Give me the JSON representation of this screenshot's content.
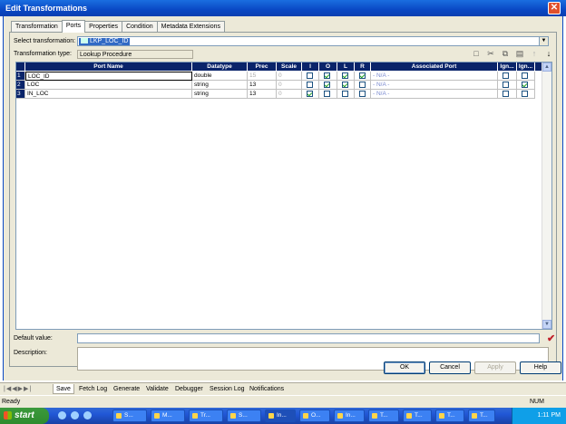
{
  "window": {
    "title": "Edit Transformations"
  },
  "tabs": [
    {
      "label": "Transformation"
    },
    {
      "label": "Ports",
      "active": true
    },
    {
      "label": "Properties"
    },
    {
      "label": "Condition"
    },
    {
      "label": "Metadata Extensions"
    }
  ],
  "form": {
    "select_label": "Select transformation:",
    "select_value": "LKP_LOC_ID",
    "type_label": "Transformation type:",
    "type_value": "Lookup Procedure",
    "default_label": "Default value:",
    "default_value": "",
    "desc_label": "Description:",
    "desc_value": ""
  },
  "grid": {
    "headers": [
      "Port Name",
      "Datatype",
      "Prec",
      "Scale",
      "I",
      "O",
      "L",
      "R",
      "Associated Port",
      "Ign...",
      "Ign..."
    ],
    "rows": [
      {
        "num": "1",
        "name": "LOC_ID",
        "type": "double",
        "prec": "15",
        "scale": "0",
        "I": false,
        "O": true,
        "L": true,
        "R": true,
        "assoc": "- N/A -",
        "ign1": false,
        "ign2": false
      },
      {
        "num": "2",
        "name": "LOC",
        "type": "string",
        "prec": "13",
        "scale": "0",
        "I": false,
        "O": true,
        "L": true,
        "R": false,
        "assoc": "- N/A -",
        "ign1": false,
        "ign2": true
      },
      {
        "num": "3",
        "name": "IN_LOC",
        "type": "string",
        "prec": "13",
        "scale": "0",
        "I": true,
        "O": false,
        "L": false,
        "R": false,
        "assoc": "- N/A -",
        "ign1": false,
        "ign2": false
      }
    ]
  },
  "buttons": {
    "ok": "OK",
    "cancel": "Cancel",
    "apply": "Apply",
    "help": "Help"
  },
  "output_tabs": [
    "Save",
    "Fetch Log",
    "Generate",
    "Validate",
    "Debugger",
    "Session Log",
    "Notifications"
  ],
  "status": {
    "text": "Ready",
    "num": "NUM"
  },
  "taskbar": {
    "start": "start",
    "items": [
      "S...",
      "M...",
      "Tr...",
      "S...",
      "In...",
      "O...",
      "In...",
      "T...",
      "T...",
      "T...",
      "T..."
    ],
    "clock": "1:11 PM"
  },
  "colors": {
    "title": "#0a48c4",
    "header": "#0a246a",
    "check": "#21a121"
  }
}
